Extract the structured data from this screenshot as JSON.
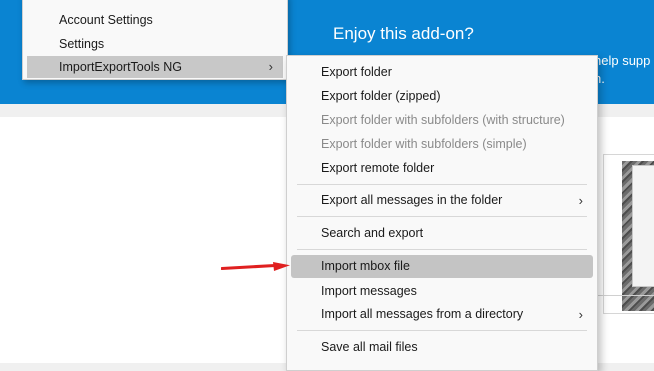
{
  "hero": {
    "title": "Enjoy this add-on?",
    "text_line1": "help supp",
    "text_line2": "n."
  },
  "parent_menu": {
    "items": [
      {
        "label": "Account Settings"
      },
      {
        "label": "Settings"
      },
      {
        "label": "ImportExportTools NG",
        "chevron": "›"
      }
    ]
  },
  "submenu": {
    "items": [
      {
        "label": "Export folder"
      },
      {
        "label": "Export folder (zipped)"
      },
      {
        "label": "Export folder with subfolders (with structure)"
      },
      {
        "label": "Export folder with subfolders (simple)"
      },
      {
        "label": "Export remote folder"
      },
      {
        "label": "Export all messages in the folder",
        "chevron": "›"
      },
      {
        "label": "Search and export"
      },
      {
        "label": "Import mbox file"
      },
      {
        "label": "Import messages"
      },
      {
        "label": "Import all messages from a directory",
        "chevron": "›"
      },
      {
        "label": "Save all mail files"
      }
    ]
  },
  "colors": {
    "hero_bg": "#0a84d2",
    "arrow": "#e02020",
    "highlight": "#c4c4c4"
  },
  "icons": {
    "pointer_arrow": "red-arrow-icon",
    "submenu_chevron": "chevron-right-icon"
  }
}
